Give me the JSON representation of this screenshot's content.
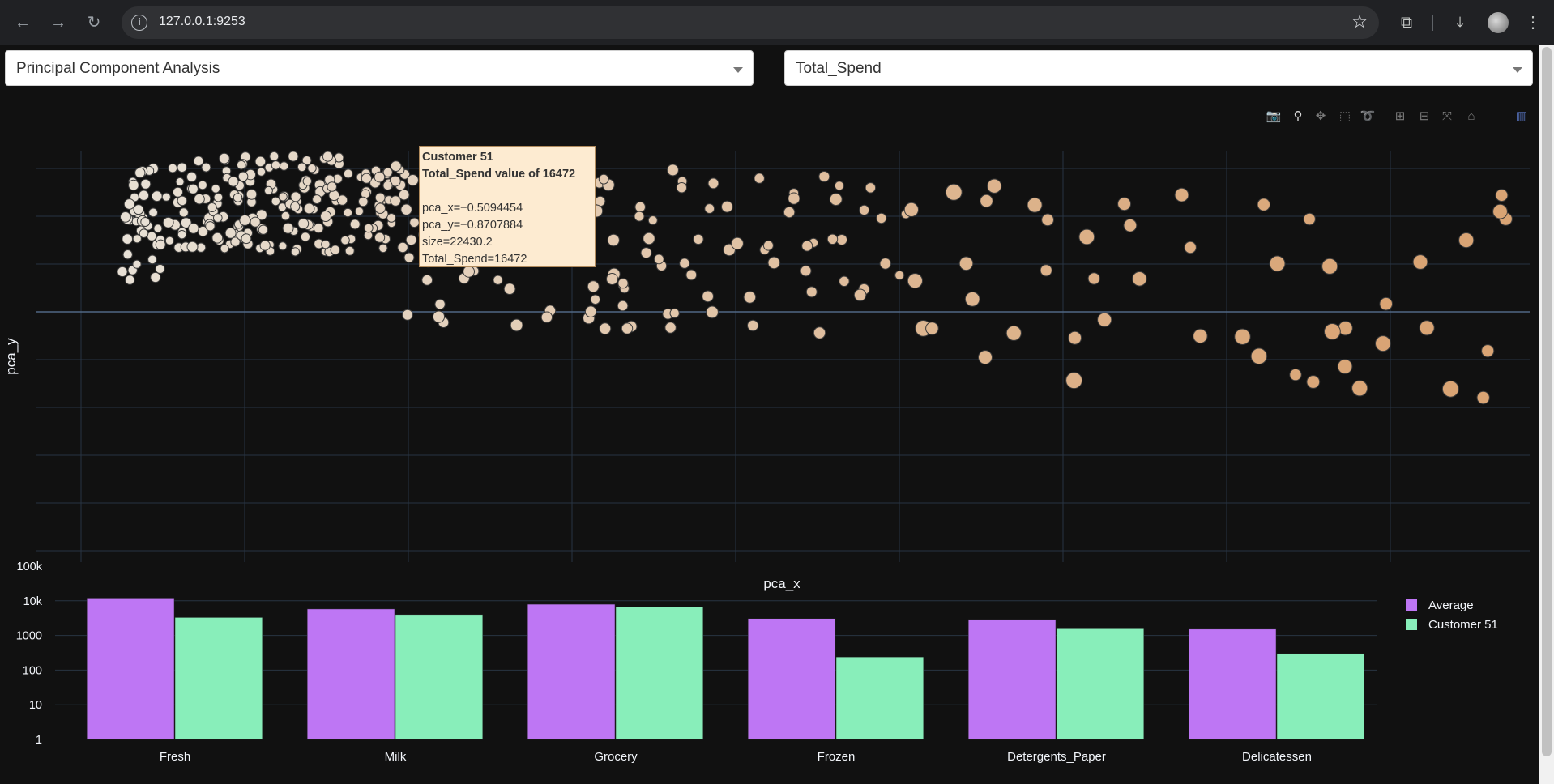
{
  "browser": {
    "url": "127.0.0.1:9253"
  },
  "controls": {
    "method_dropdown": "Principal Component Analysis",
    "metric_dropdown": "Total_Spend"
  },
  "scatter": {
    "xlabel": "pca_x",
    "ylabel": "pca_y",
    "marker_color_low": "#e8e2d8",
    "marker_color_high": "#d9a474",
    "tooltip": {
      "title": "Customer 51",
      "subtitle": "Total_Spend value of 16472",
      "line_x": "pca_x=−0.5094454",
      "line_y": "pca_y=−0.8707884",
      "line_size": "size=22430.2",
      "line_spend": "Total_Spend=16472"
    }
  },
  "chart_data": {
    "type": "bar",
    "log_y": true,
    "categories": [
      "Fresh",
      "Milk",
      "Grocery",
      "Frozen",
      "Detergents_Paper",
      "Delicatessen"
    ],
    "series": [
      {
        "name": "Average",
        "color": "#be76f4",
        "values": [
          12000,
          5800,
          7950,
          3070,
          2880,
          1520
        ]
      },
      {
        "name": "Customer 51",
        "color": "#88eeba",
        "values": [
          3300,
          4000,
          6700,
          240,
          1560,
          300
        ]
      }
    ],
    "y_ticks": [
      "1",
      "10",
      "100",
      "1000",
      "10k",
      "100k"
    ],
    "ylim": [
      1,
      100000
    ],
    "grid": true,
    "legend": "top-right"
  }
}
